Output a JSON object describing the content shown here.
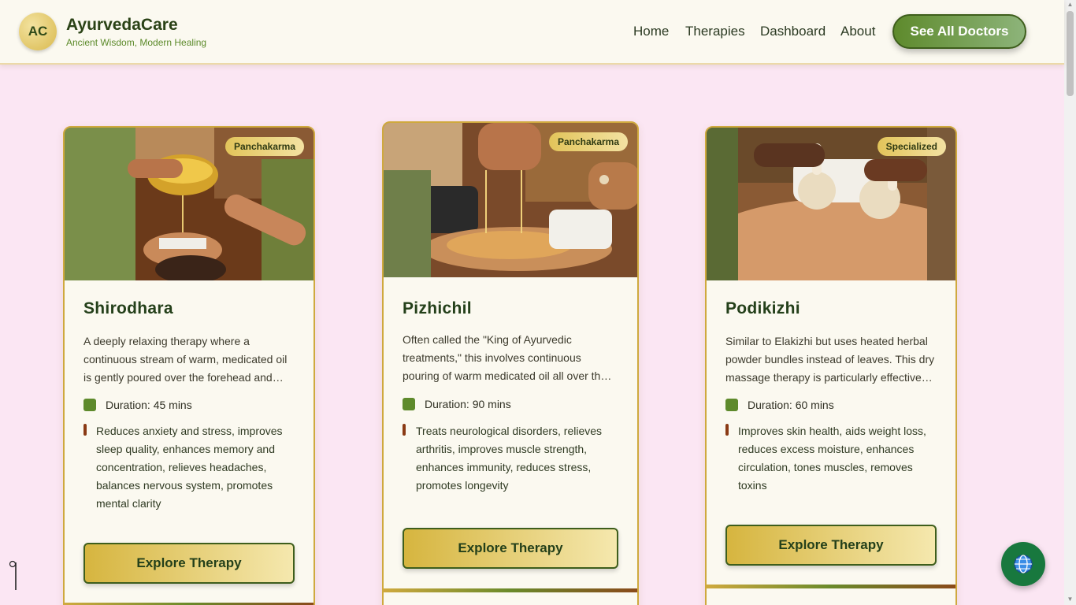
{
  "brand": {
    "logo_initials": "AC",
    "name": "AyurvedaCare",
    "tagline": "Ancient Wisdom, Modern Healing"
  },
  "nav": {
    "items": [
      "Home",
      "Therapies",
      "Dashboard",
      "About"
    ],
    "cta_label": "See All Doctors"
  },
  "cards": [
    {
      "badge": "Panchakarma",
      "title": "Shirodhara",
      "description": "A deeply relaxing therapy where a continuous stream of warm, medicated oil is gently poured over the forehead and…",
      "duration": "Duration: 45 mins",
      "benefits": "Reduces anxiety and stress, improves sleep quality, enhances memory and concentration, relieves headaches, balances nervous system, promotes mental clarity",
      "button_label": "Explore Therapy"
    },
    {
      "badge": "Panchakarma",
      "title": "Pizhichil",
      "description": "Often called the \"King of Ayurvedic treatments,\" this involves continuous pouring of warm medicated oil all over th…",
      "duration": "Duration: 90 mins",
      "benefits": "Treats neurological disorders, relieves arthritis, improves muscle strength, enhances immunity, reduces stress, promotes longevity",
      "button_label": "Explore Therapy"
    },
    {
      "badge": "Specialized",
      "title": "Podikizhi",
      "description": "Similar to Elakizhi but uses heated herbal powder bundles instead of leaves. This dry massage therapy is particularly effective…",
      "duration": "Duration: 60 mins",
      "benefits": "Improves skin health, aids weight loss, reduces excess moisture, enhances circulation, tones muscles, removes toxins",
      "button_label": "Explore Therapy"
    }
  ],
  "icons": {
    "duration": "square-icon",
    "globe": "globe-icon"
  },
  "colors": {
    "page_bg": "#fbe6f3",
    "header_bg": "#fbf9f0",
    "primary_green": "#5e8a2c",
    "gold": "#d6b53f",
    "benefit_accent": "#8a3a14",
    "globe_button": "#18783e"
  }
}
